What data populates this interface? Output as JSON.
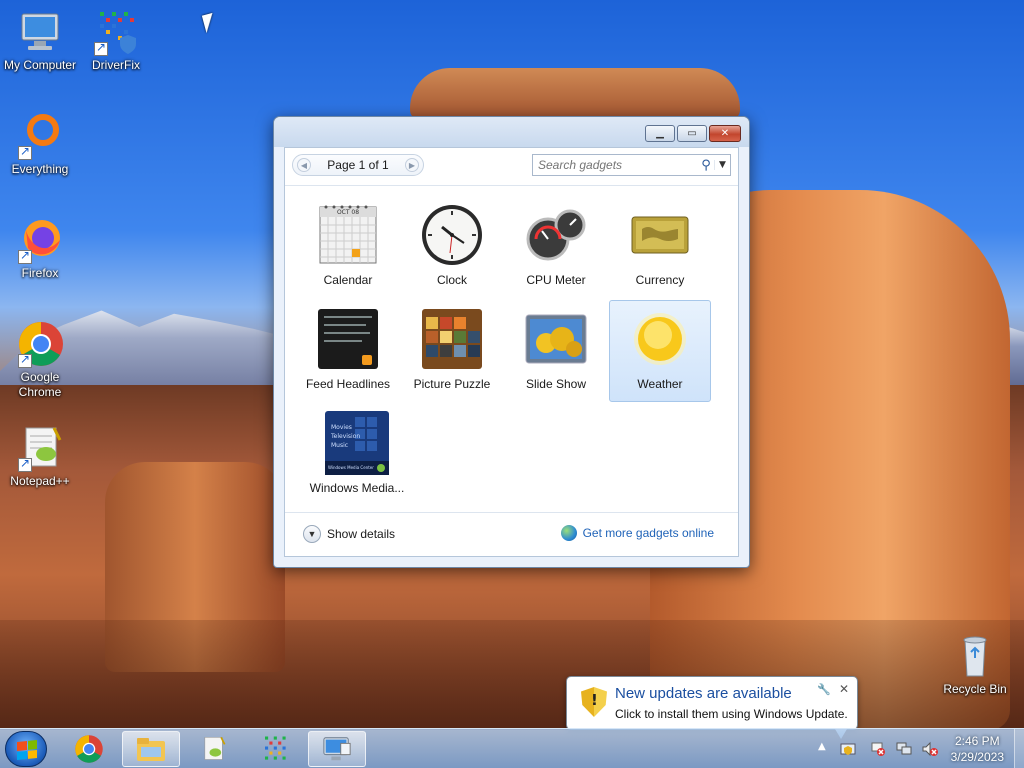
{
  "desktop": {
    "icons": [
      {
        "label": "My Computer"
      },
      {
        "label": "DriverFix"
      },
      {
        "label": "Everything"
      },
      {
        "label": "Firefox"
      },
      {
        "label": "Google Chrome"
      },
      {
        "label": "Notepad++"
      },
      {
        "label": "Recycle Bin"
      }
    ]
  },
  "gadget_window": {
    "pager": {
      "label": "Page 1 of 1"
    },
    "search": {
      "placeholder": "Search gadgets"
    },
    "gadgets": [
      {
        "name": "Calendar",
        "icon": "calendar-icon",
        "calendar_month": "OCT 08"
      },
      {
        "name": "Clock",
        "icon": "clock-icon"
      },
      {
        "name": "CPU Meter",
        "icon": "cpu-meter-icon"
      },
      {
        "name": "Currency",
        "icon": "currency-icon"
      },
      {
        "name": "Feed Headlines",
        "icon": "rss-icon"
      },
      {
        "name": "Picture Puzzle",
        "icon": "puzzle-icon"
      },
      {
        "name": "Slide Show",
        "icon": "slideshow-icon"
      },
      {
        "name": "Weather",
        "icon": "weather-sun-icon",
        "selected": true
      },
      {
        "name": "Windows Media...",
        "icon": "media-center-icon",
        "menu_items": [
          "Movies",
          "Television",
          "Music"
        ],
        "brand": "Windows Media Center"
      }
    ],
    "footer": {
      "show_details": "Show details",
      "get_more": "Get more gadgets online"
    }
  },
  "notification": {
    "title": "New updates are available",
    "message": "Click to install them using Windows Update."
  },
  "taskbar": {
    "clock": {
      "time": "2:46 PM",
      "date": "3/29/2023"
    }
  },
  "colors": {
    "link": "#1f63b8",
    "balloon_title": "#1b4fa0",
    "selection": "#cfe3fa"
  }
}
